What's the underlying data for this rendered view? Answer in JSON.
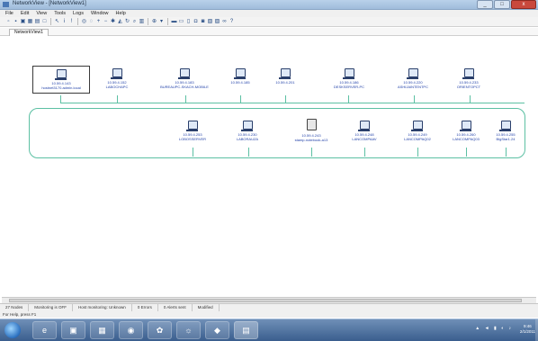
{
  "window": {
    "title": "NetworkView - [NetworkView1]",
    "min": "_",
    "max": "□",
    "close": "x"
  },
  "menu": [
    "File",
    "Edit",
    "View",
    "Tools",
    "Logs",
    "Window",
    "Help"
  ],
  "document_tab": "NetworkView1",
  "nodes_row1": [
    {
      "ip": "10.59.4.143",
      "name": "hostnet3170.admin.local"
    },
    {
      "ip": "10.59.4.152",
      "name": "LABOCHAPC"
    },
    {
      "ip": "10.59.4.183",
      "name": "BUREAUPC-SKACH-MOBILE"
    },
    {
      "ip": "10.59.4.185",
      "name": ""
    },
    {
      "ip": "10.59.4.201",
      "name": ""
    },
    {
      "ip": "10.59.4.186",
      "name": "DESKSERVER-PC"
    },
    {
      "ip": "10.59.4.220",
      "name": "ASHIJAINTENTPC"
    },
    {
      "ip": "10.59.4.233",
      "name": "ORIENTOPCT"
    }
  ],
  "nodes_row2": [
    {
      "ip": "10.59.4.253",
      "name": "LOBOSSERVER"
    },
    {
      "ip": "10.59.4.230",
      "name": "LABORAUZA"
    },
    {
      "ip": "10.59.4.243",
      "name": "stamp-notebook-a13"
    },
    {
      "ip": "10.59.4.248",
      "name": "LANCOMPAAV"
    },
    {
      "ip": "10.59.4.249",
      "name": "LANCOMPAQ02"
    },
    {
      "ip": "10.59.4.260",
      "name": "LANCOMPAQ03"
    },
    {
      "ip": "10.59.4.255",
      "name": "BigStar1.24"
    }
  ],
  "status": [
    "27 Nodes",
    "Monitoring is OFF",
    "Host monitoring: Unknown",
    "0 Errors",
    "0 Alerts sent",
    "Modified"
  ],
  "hint": "For Help, press F1",
  "taskbar": {
    "items": [
      "e",
      "▣",
      "▦",
      "◉",
      "✿",
      "☼",
      "◆",
      "▤"
    ],
    "tray": "▲ ◄ ▮ ◐ ♪",
    "time": "9:46",
    "date": "2/1/2011"
  }
}
